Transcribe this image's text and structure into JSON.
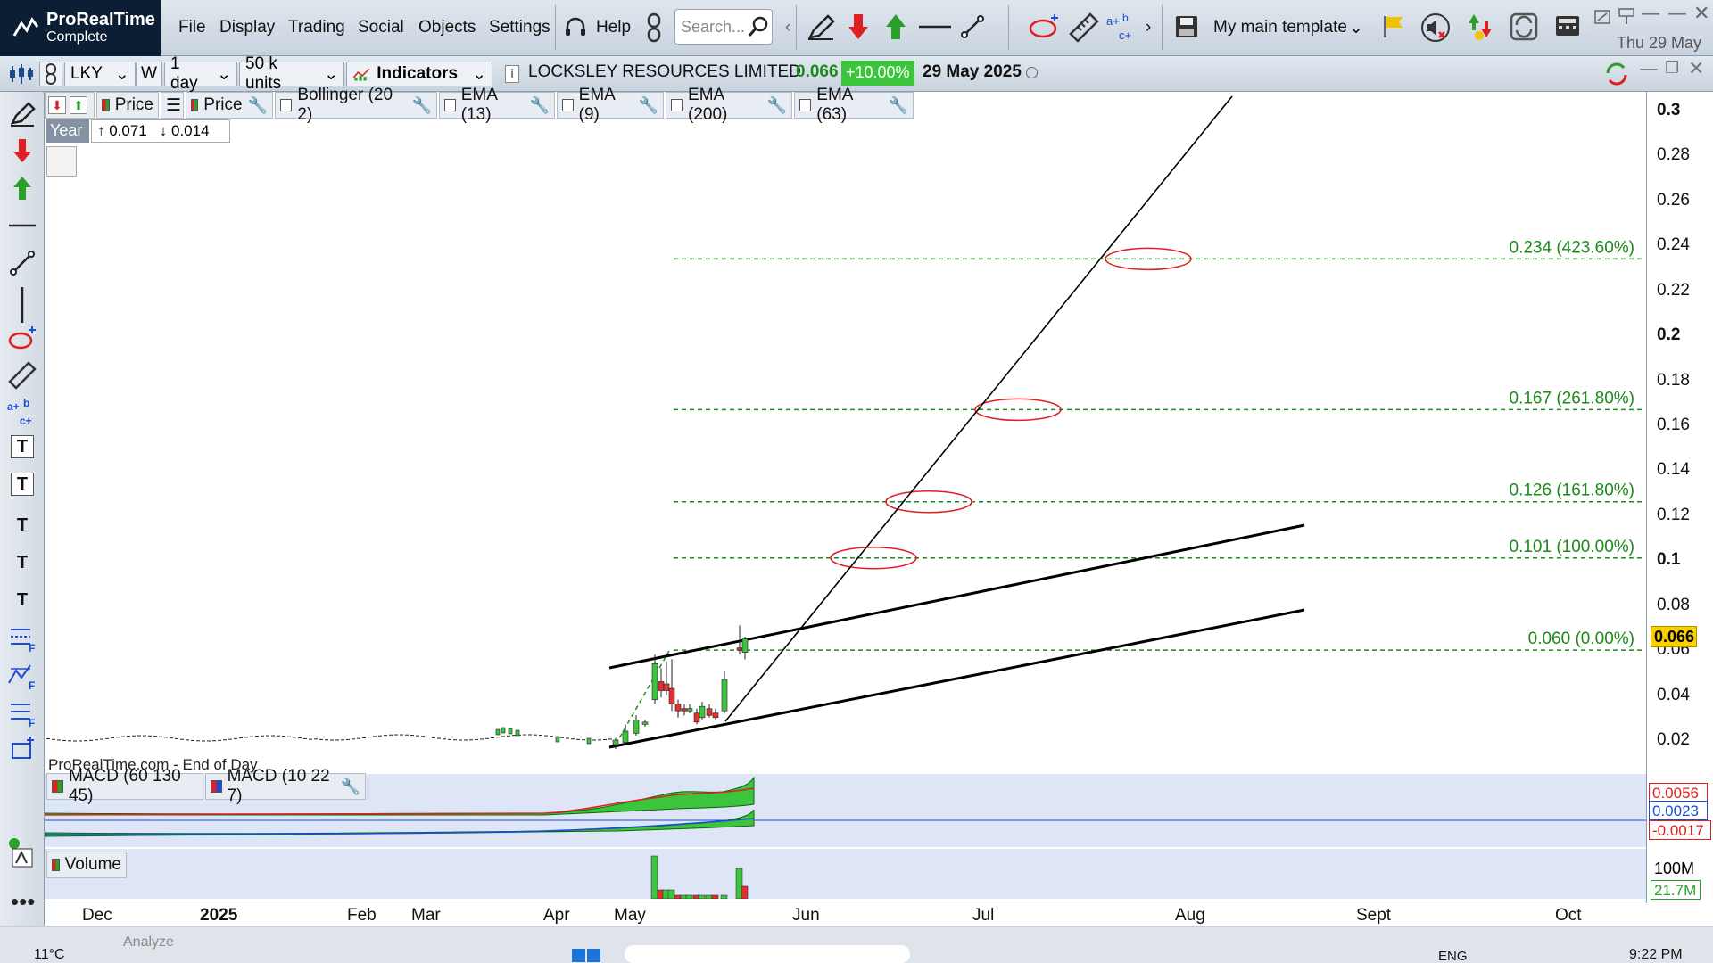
{
  "app": {
    "name": "ProRealTime",
    "edition": "Complete"
  },
  "menu": [
    "File",
    "Display",
    "Trading",
    "Social",
    "Objects",
    "Settings",
    "Help"
  ],
  "search": {
    "placeholder": "Search..."
  },
  "template": {
    "label": "My main template"
  },
  "datetime": "Thu 29 May",
  "toolbar2": {
    "ticker": "LKY",
    "period_code": "W",
    "timeframe": "1 day",
    "units": "50 k units",
    "indicators_label": "Indicators",
    "instrument": "LOCKSLEY RESOURCES LIMITED",
    "last_price": "0.066",
    "change": "+10.00%",
    "date": "29 May 2025"
  },
  "overlays": [
    "Price",
    "Price",
    "Bollinger (20 2)",
    "EMA (13)",
    "EMA (9)",
    "EMA (200)",
    "EMA (63)"
  ],
  "range": {
    "label": "Year",
    "high": "↑ 0.071",
    "low": "↓ 0.014"
  },
  "watermark": "ProRealTime.com - End of Day",
  "yaxis": [
    "0.3",
    "0.28",
    "0.26",
    "0.24",
    "0.22",
    "0.2",
    "0.18",
    "0.16",
    "0.14",
    "0.12",
    "0.1",
    "0.08",
    "0.06",
    "0.04",
    "0.02"
  ],
  "price_tag": "0.066",
  "fib": [
    {
      "label": "0.234 (423.60%)",
      "value": 0.234
    },
    {
      "label": "0.167 (261.80%)",
      "value": 0.167
    },
    {
      "label": "0.126 (161.80%)",
      "value": 0.126
    },
    {
      "label": "0.101 (100.00%)",
      "value": 0.101
    },
    {
      "label": "0.060 (0.00%)",
      "value": 0.06
    }
  ],
  "macd": {
    "labels": [
      "MACD (60 130 45)",
      "MACD (10 22 7)"
    ],
    "values": [
      "0.0056",
      "0.0023",
      "-0.0017"
    ]
  },
  "volume": {
    "label": "Volume",
    "axis": "100M",
    "last": "21.7M"
  },
  "xaxis": [
    "Dec",
    "2025",
    "Feb",
    "Mar",
    "Apr",
    "May",
    "Jun",
    "Jul",
    "Aug",
    "Sept",
    "Oct"
  ],
  "taskbar": {
    "weather": "11°C",
    "lang": "ENG",
    "time": "9:22 PM",
    "analyze": "Analyze"
  },
  "colors": {
    "up": "#3dc43d",
    "down": "#e03030",
    "fib": "#1a8a1a",
    "macd_bg": "#dde5f7"
  }
}
